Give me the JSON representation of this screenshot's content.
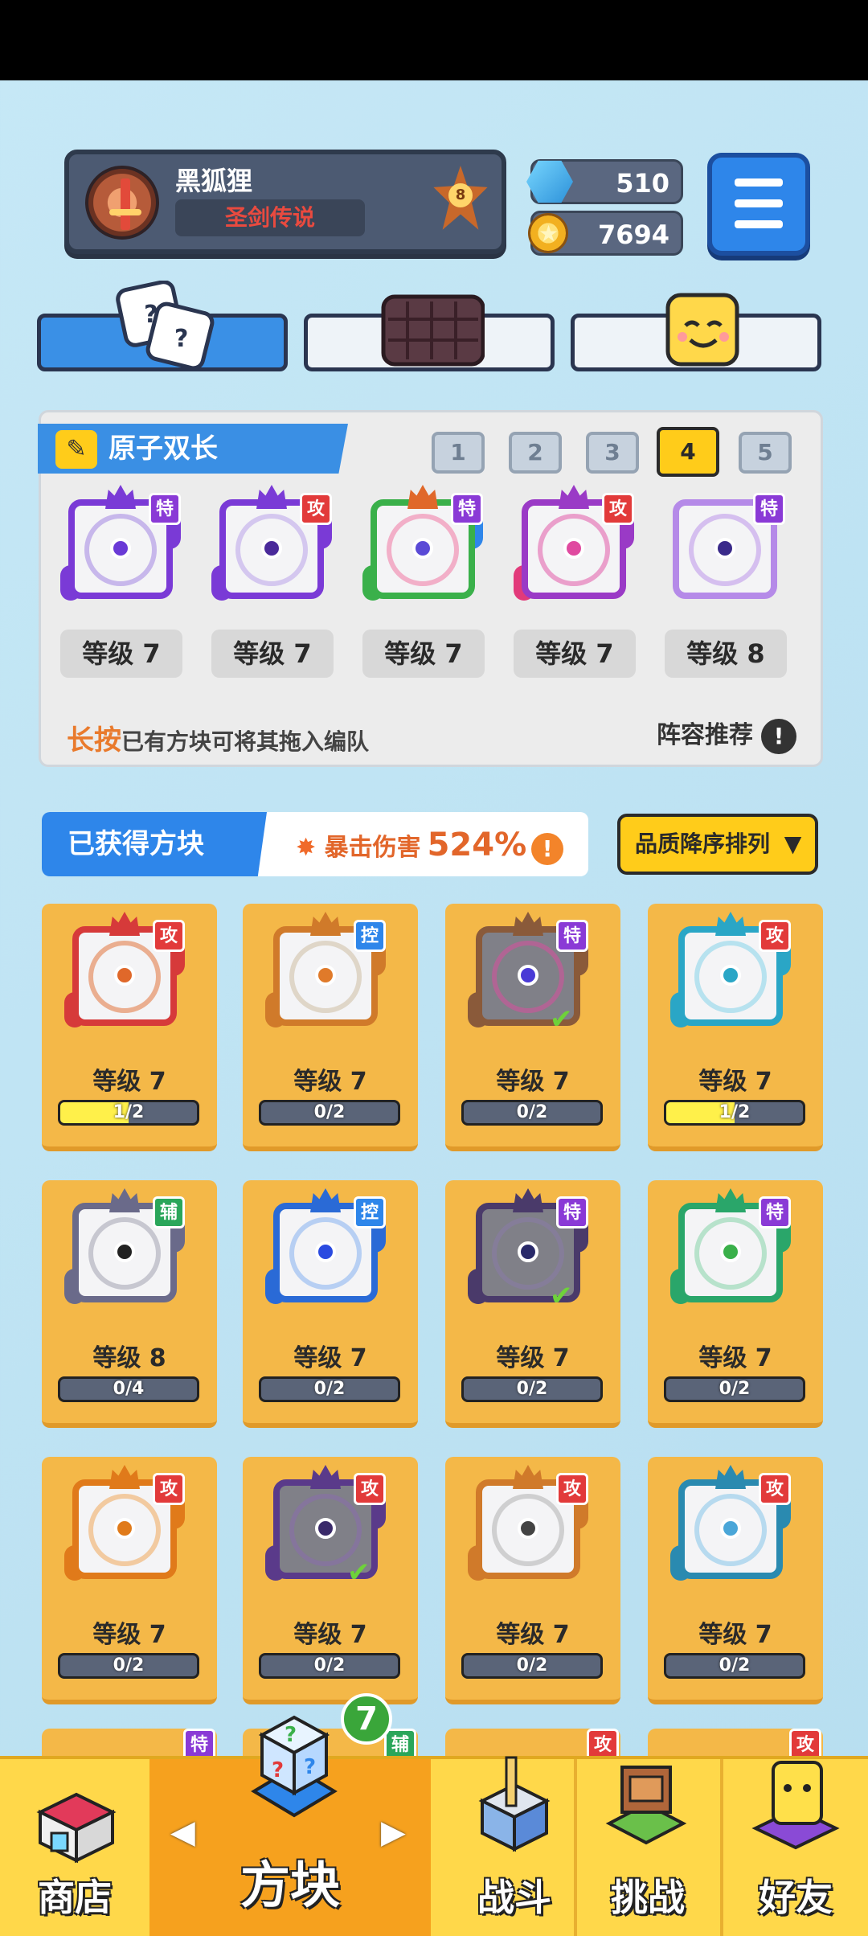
{
  "profile": {
    "name": "黑狐狸",
    "title": "圣剑传说",
    "rank": "8"
  },
  "currency": {
    "gems": "510",
    "coins": "7694"
  },
  "lineup": {
    "title": "原子双长",
    "tabs": [
      "1",
      "2",
      "3",
      "4",
      "5"
    ],
    "active_tab": "4",
    "cards": [
      {
        "tag": "特",
        "level": "等级 7"
      },
      {
        "tag": "攻",
        "level": "等级 7"
      },
      {
        "tag": "特",
        "level": "等级 7"
      },
      {
        "tag": "攻",
        "level": "等级 7"
      },
      {
        "tag": "特",
        "level": "等级 8"
      }
    ],
    "hint_highlight": "长按",
    "hint_text": "已有方块可将其拖入编队",
    "recommend": "阵容推荐",
    "recommend_icon": "!"
  },
  "obtained": {
    "title": "已获得方块",
    "crit_label": "暴击伤害",
    "crit_value": "524%",
    "crit_icon": "!",
    "sort_label": "品质降序排列"
  },
  "cards": [
    {
      "tag": "攻",
      "level": "等级 7",
      "progress": "1/2",
      "fill": 0.5
    },
    {
      "tag": "控",
      "level": "等级 7",
      "progress": "0/2",
      "fill": 0
    },
    {
      "tag": "特",
      "level": "等级 7",
      "progress": "0/2",
      "fill": 0
    },
    {
      "tag": "攻",
      "level": "等级 7",
      "progress": "1/2",
      "fill": 0.5
    },
    {
      "tag": "辅",
      "level": "等级 8",
      "progress": "0/4",
      "fill": 0
    },
    {
      "tag": "控",
      "level": "等级 7",
      "progress": "0/2",
      "fill": 0
    },
    {
      "tag": "特",
      "level": "等级 7",
      "progress": "0/2",
      "fill": 0
    },
    {
      "tag": "特",
      "level": "等级 7",
      "progress": "0/2",
      "fill": 0
    },
    {
      "tag": "攻",
      "level": "等级 7",
      "progress": "0/2",
      "fill": 0
    },
    {
      "tag": "攻",
      "level": "等级 7",
      "progress": "0/2",
      "fill": 0
    },
    {
      "tag": "攻",
      "level": "等级 7",
      "progress": "0/2",
      "fill": 0
    },
    {
      "tag": "攻",
      "level": "等级 7",
      "progress": "0/2",
      "fill": 0
    }
  ],
  "partial_tags": [
    "特",
    "辅",
    "攻",
    "攻"
  ],
  "nav": {
    "shop": "商店",
    "blocks": "方块",
    "battle": "战斗",
    "challenge": "挑战",
    "friends": "好友",
    "badge": "7"
  },
  "colors": {
    "攻": "#e23a3a",
    "控": "#2e86ea",
    "特": "#8a3ad6",
    "辅": "#2aa65a"
  }
}
